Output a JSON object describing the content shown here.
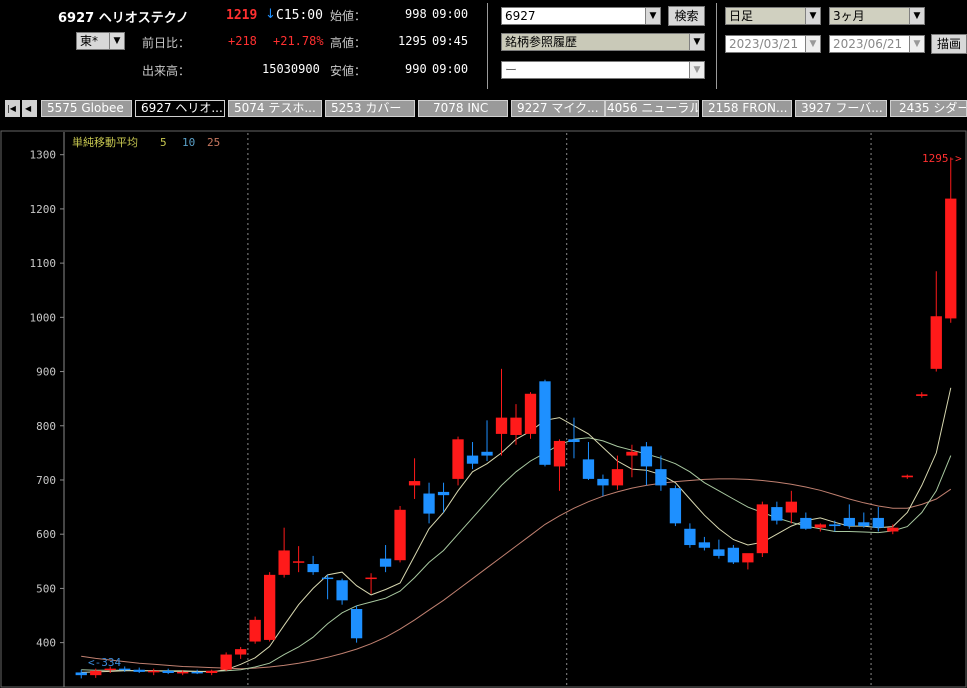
{
  "stock": {
    "code_name": "6927 ヘリオステクノ",
    "price": "1219",
    "arrow": "↓",
    "time": "C15:00",
    "market": "東*",
    "change_label": "前日比：",
    "change_value": "+218",
    "change_pct": "+21.78%",
    "volume_label": "出来高：",
    "volume": "15030900",
    "open_label": "始値：",
    "open_value": "998",
    "open_time": "09:00",
    "high_label": "高値：",
    "high_value": "1295",
    "high_time": "09:45",
    "low_label": "安値：",
    "low_value": "990",
    "low_time": "09:00"
  },
  "controls": {
    "code_input": "6927",
    "search_button": "検索",
    "history_select": "銘柄参照履歴",
    "third_select": "ー",
    "period_select": "日足",
    "range_select": "3ヶ月",
    "date_from": "2023/03/21",
    "date_to": "2023/06/21",
    "draw_button": "描画"
  },
  "tabs": [
    {
      "label": "5575 Globee"
    },
    {
      "label": "6927 ヘリオ..."
    },
    {
      "label": "5074 テスホ..."
    },
    {
      "label": "5253 カバー"
    },
    {
      "label": "7078 INC"
    },
    {
      "label": "9227 マイク..."
    },
    {
      "label": "4056 ニューラル"
    },
    {
      "label": "2158 FRON..."
    },
    {
      "label": "3927 フーバ..."
    },
    {
      "label": "2435 シダー"
    }
  ],
  "tab_nav": {
    "first": "|◀",
    "prev": "◀"
  },
  "colors": {
    "up": "#ff1a1a",
    "down": "#1e90ff",
    "ma5": "#d8d8b0",
    "ma10": "#a8c8a0",
    "ma25": "#c08070",
    "grid": "#8a8a8a",
    "axis_text": "#c8c8c8"
  },
  "chart_data": {
    "type": "candlestick",
    "ma_label": "単純移動平均",
    "ma_periods": [
      "5",
      "10",
      "25"
    ],
    "yticks": [
      400,
      500,
      600,
      700,
      800,
      900,
      1000,
      1100,
      1200,
      1300
    ],
    "ylim": [
      320,
      1340
    ],
    "high_annotation": "1295->",
    "low_annotation": "<-334",
    "candles": [
      {
        "o": 345,
        "h": 350,
        "l": 334,
        "c": 340
      },
      {
        "o": 340,
        "h": 352,
        "l": 335,
        "c": 348
      },
      {
        "o": 350,
        "h": 356,
        "l": 344,
        "c": 352
      },
      {
        "o": 352,
        "h": 356,
        "l": 346,
        "c": 350
      },
      {
        "o": 350,
        "h": 354,
        "l": 344,
        "c": 346
      },
      {
        "o": 346,
        "h": 352,
        "l": 340,
        "c": 348
      },
      {
        "o": 348,
        "h": 352,
        "l": 342,
        "c": 344
      },
      {
        "o": 344,
        "h": 349,
        "l": 340,
        "c": 346
      },
      {
        "o": 346,
        "h": 350,
        "l": 342,
        "c": 344
      },
      {
        "o": 344,
        "h": 350,
        "l": 340,
        "c": 348
      },
      {
        "o": 350,
        "h": 382,
        "l": 348,
        "c": 378
      },
      {
        "o": 378,
        "h": 392,
        "l": 370,
        "c": 388
      },
      {
        "o": 402,
        "h": 448,
        "l": 398,
        "c": 442
      },
      {
        "o": 405,
        "h": 530,
        "l": 402,
        "c": 525
      },
      {
        "o": 525,
        "h": 612,
        "l": 520,
        "c": 570
      },
      {
        "o": 548,
        "h": 578,
        "l": 530,
        "c": 550
      },
      {
        "o": 545,
        "h": 560,
        "l": 525,
        "c": 530
      },
      {
        "o": 520,
        "h": 525,
        "l": 480,
        "c": 518
      },
      {
        "o": 515,
        "h": 518,
        "l": 470,
        "c": 478
      },
      {
        "o": 462,
        "h": 468,
        "l": 400,
        "c": 408
      },
      {
        "o": 520,
        "h": 528,
        "l": 490,
        "c": 520
      },
      {
        "o": 555,
        "h": 580,
        "l": 530,
        "c": 540
      },
      {
        "o": 552,
        "h": 652,
        "l": 548,
        "c": 645
      },
      {
        "o": 690,
        "h": 740,
        "l": 665,
        "c": 698
      },
      {
        "o": 675,
        "h": 695,
        "l": 620,
        "c": 638
      },
      {
        "o": 678,
        "h": 695,
        "l": 640,
        "c": 672
      },
      {
        "o": 702,
        "h": 780,
        "l": 690,
        "c": 775
      },
      {
        "o": 745,
        "h": 770,
        "l": 720,
        "c": 730
      },
      {
        "o": 752,
        "h": 810,
        "l": 735,
        "c": 745
      },
      {
        "o": 785,
        "h": 905,
        "l": 745,
        "c": 815
      },
      {
        "o": 783,
        "h": 840,
        "l": 765,
        "c": 815
      },
      {
        "o": 785,
        "h": 862,
        "l": 776,
        "c": 859
      },
      {
        "o": 882,
        "h": 885,
        "l": 725,
        "c": 728
      },
      {
        "o": 725,
        "h": 775,
        "l": 680,
        "c": 772
      },
      {
        "o": 775,
        "h": 815,
        "l": 740,
        "c": 770
      },
      {
        "o": 738,
        "h": 770,
        "l": 700,
        "c": 702
      },
      {
        "o": 702,
        "h": 710,
        "l": 670,
        "c": 690
      },
      {
        "o": 690,
        "h": 745,
        "l": 682,
        "c": 720
      },
      {
        "o": 745,
        "h": 765,
        "l": 705,
        "c": 752
      },
      {
        "o": 762,
        "h": 770,
        "l": 690,
        "c": 725
      },
      {
        "o": 720,
        "h": 745,
        "l": 680,
        "c": 690
      },
      {
        "o": 685,
        "h": 690,
        "l": 615,
        "c": 620
      },
      {
        "o": 610,
        "h": 620,
        "l": 575,
        "c": 580
      },
      {
        "o": 585,
        "h": 595,
        "l": 570,
        "c": 575
      },
      {
        "o": 572,
        "h": 590,
        "l": 555,
        "c": 560
      },
      {
        "o": 575,
        "h": 580,
        "l": 545,
        "c": 548
      },
      {
        "o": 548,
        "h": 560,
        "l": 535,
        "c": 565
      },
      {
        "o": 565,
        "h": 660,
        "l": 558,
        "c": 655
      },
      {
        "o": 650,
        "h": 660,
        "l": 618,
        "c": 625
      },
      {
        "o": 640,
        "h": 680,
        "l": 620,
        "c": 660
      },
      {
        "o": 630,
        "h": 640,
        "l": 608,
        "c": 610
      },
      {
        "o": 612,
        "h": 620,
        "l": 605,
        "c": 618
      },
      {
        "o": 618,
        "h": 625,
        "l": 605,
        "c": 615
      },
      {
        "o": 630,
        "h": 655,
        "l": 610,
        "c": 615
      },
      {
        "o": 622,
        "h": 640,
        "l": 612,
        "c": 615
      },
      {
        "o": 630,
        "h": 650,
        "l": 605,
        "c": 612
      },
      {
        "o": 605,
        "h": 618,
        "l": 600,
        "c": 612
      },
      {
        "o": 705,
        "h": 710,
        "l": 702,
        "c": 708
      },
      {
        "o": 855,
        "h": 862,
        "l": 852,
        "c": 858
      },
      {
        "o": 905,
        "h": 1085,
        "l": 900,
        "c": 1002
      },
      {
        "o": 998,
        "h": 1295,
        "l": 990,
        "c": 1219
      }
    ],
    "ma5": [
      345,
      346,
      347,
      348,
      348,
      348,
      347,
      347,
      347,
      346,
      350,
      360,
      372,
      393,
      432,
      470,
      500,
      525,
      530,
      505,
      488,
      498,
      510,
      560,
      610,
      640,
      680,
      715,
      730,
      750,
      775,
      790,
      810,
      815,
      800,
      785,
      760,
      735,
      720,
      718,
      710,
      695,
      665,
      635,
      610,
      590,
      580,
      585,
      600,
      615,
      625,
      630,
      622,
      615,
      615,
      612,
      614,
      640,
      690,
      750,
      870
    ],
    "ma10": [
      350,
      349,
      349,
      349,
      348,
      348,
      348,
      348,
      347,
      347,
      348,
      350,
      355,
      362,
      378,
      392,
      410,
      435,
      455,
      468,
      475,
      482,
      495,
      520,
      548,
      570,
      600,
      630,
      660,
      690,
      715,
      735,
      750,
      765,
      775,
      778,
      772,
      762,
      755,
      748,
      740,
      730,
      715,
      695,
      680,
      665,
      650,
      640,
      630,
      622,
      615,
      610,
      605,
      605,
      604,
      603,
      606,
      614,
      640,
      680,
      745
    ],
    "ma25": [
      375,
      371,
      368,
      365,
      362,
      360,
      358,
      356,
      355,
      354,
      353,
      352,
      353,
      355,
      358,
      362,
      367,
      373,
      380,
      388,
      398,
      410,
      425,
      442,
      460,
      478,
      498,
      518,
      538,
      558,
      578,
      598,
      618,
      634,
      648,
      660,
      670,
      678,
      685,
      690,
      694,
      697,
      699,
      701,
      702,
      702,
      701,
      699,
      696,
      692,
      687,
      681,
      673,
      665,
      658,
      652,
      648,
      648,
      655,
      665,
      683
    ]
  }
}
